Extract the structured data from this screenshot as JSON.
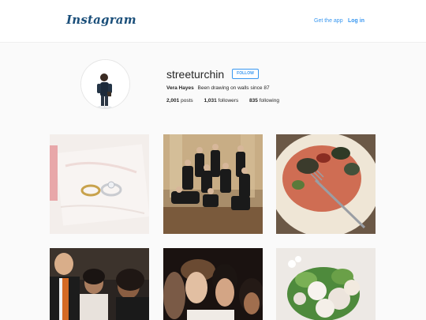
{
  "header": {
    "logo_text": "Instagram",
    "get_app_label": "Get the app",
    "login_label": "Log in"
  },
  "profile": {
    "username": "streeturchin",
    "follow_label": "FOLLOW",
    "full_name": "Vera Hayes",
    "bio": "Been drawing on walls since 87",
    "stats": {
      "posts_count": "2,001",
      "posts_label": "posts",
      "followers_count": "1,031",
      "followers_label": "followers",
      "following_count": "835",
      "following_label": "following"
    }
  },
  "colors": {
    "link": "#3897f0",
    "logo": "#1b4f7a",
    "background": "#fafafa"
  },
  "posts": [
    {
      "subject": "wedding-rings"
    },
    {
      "subject": "group-of-men-in-suits"
    },
    {
      "subject": "plate-of-food"
    },
    {
      "subject": "party-people"
    },
    {
      "subject": "selfie-group"
    },
    {
      "subject": "flower-bouquet"
    }
  ]
}
